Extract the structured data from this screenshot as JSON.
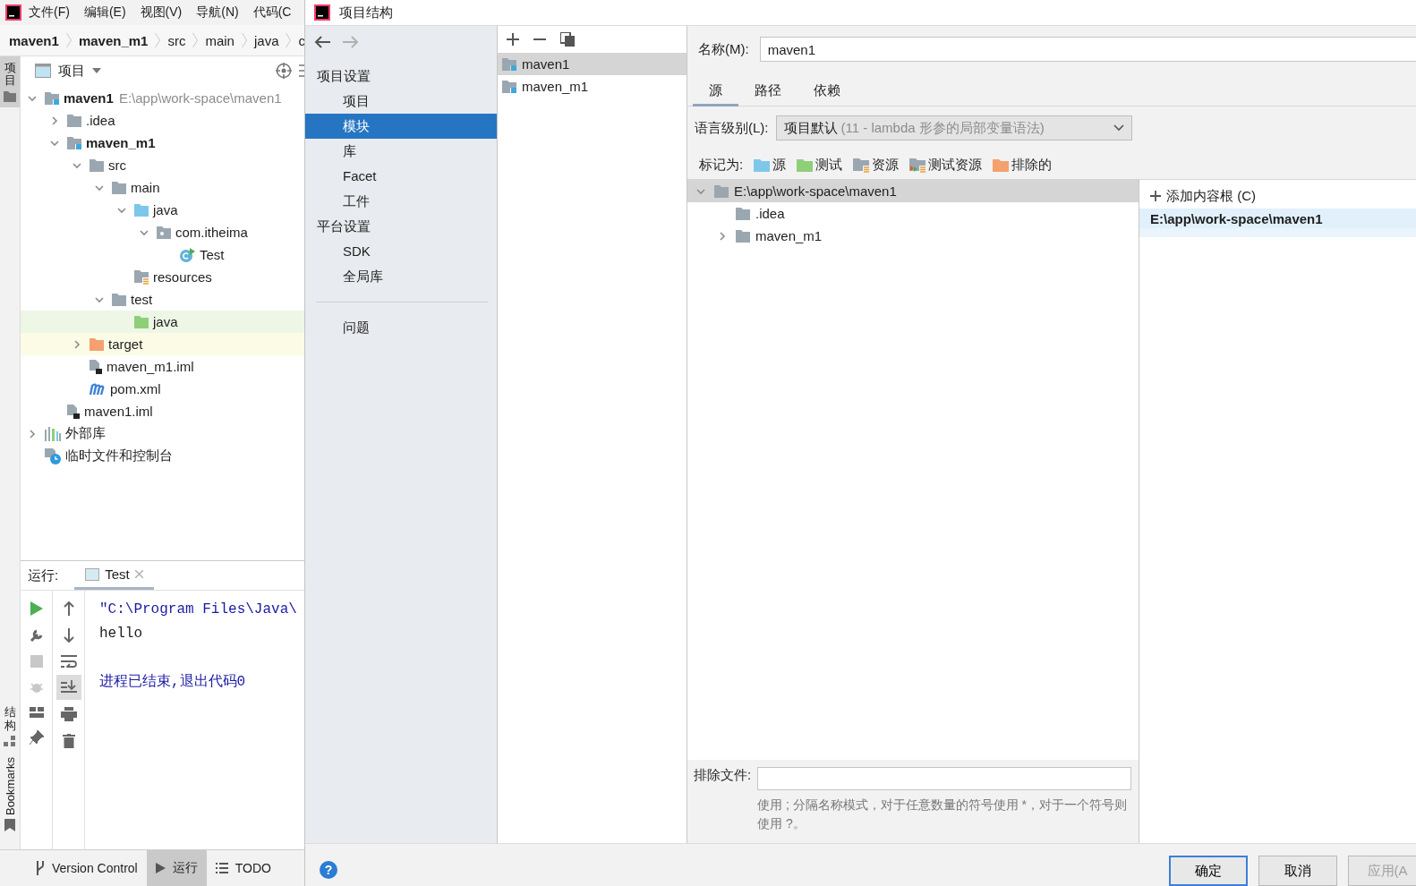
{
  "ide": {
    "menu": [
      "文件(F)",
      "编辑(E)",
      "视图(V)",
      "导航(N)",
      "代码(C"
    ],
    "breadcrumb": [
      {
        "label": "maven1",
        "bold": true
      },
      {
        "label": "maven_m1",
        "bold": true
      },
      {
        "label": "src",
        "bold": false
      },
      {
        "label": "main",
        "bold": false
      },
      {
        "label": "java",
        "bold": false
      },
      {
        "label": "c",
        "bold": false
      }
    ],
    "tool_windows": [
      {
        "label": "项目",
        "kind": "stacked",
        "selected": true
      },
      {
        "label": "结构",
        "kind": "stacked",
        "selected": false
      },
      {
        "label": "Bookmarks",
        "kind": "rotated",
        "selected": false
      }
    ],
    "project_panel": {
      "title": "项目",
      "tree": [
        {
          "label": "maven1",
          "kind": "module",
          "bold": true,
          "hint": "E:\\app\\work-space\\maven1",
          "expanded": true,
          "children": [
            {
              "label": ".idea",
              "kind": "folder",
              "expanded": false
            },
            {
              "label": "maven_m1",
              "kind": "module",
              "bold": true,
              "expanded": true,
              "children": [
                {
                  "label": "src",
                  "kind": "folder",
                  "expanded": true,
                  "children": [
                    {
                      "label": "main",
                      "kind": "folder",
                      "expanded": true,
                      "children": [
                        {
                          "label": "java",
                          "kind": "source",
                          "expanded": true,
                          "children": [
                            {
                              "label": "com.itheima",
                              "kind": "package",
                              "expanded": true,
                              "children": [
                                {
                                  "label": "Test",
                                  "kind": "class"
                                }
                              ]
                            }
                          ]
                        },
                        {
                          "label": "resources",
                          "kind": "resources"
                        }
                      ]
                    },
                    {
                      "label": "test",
                      "kind": "folder",
                      "expanded": true,
                      "children": [
                        {
                          "label": "java",
                          "kind": "test",
                          "color": "#eef7e6"
                        }
                      ]
                    }
                  ]
                },
                {
                  "label": "target",
                  "kind": "excluded",
                  "expanded": false,
                  "color": "#fcfce6"
                },
                {
                  "label": "maven_m1.iml",
                  "kind": "iml"
                },
                {
                  "label": "pom.xml",
                  "kind": "maven"
                }
              ]
            },
            {
              "label": "maven1.iml",
              "kind": "iml"
            }
          ]
        },
        {
          "label": "外部库",
          "kind": "libraries",
          "expanded": false
        },
        {
          "label": "临时文件和控制台",
          "kind": "scratches"
        }
      ]
    },
    "run_panel": {
      "label": "运行:",
      "tab": {
        "label": "Test",
        "selected": true
      },
      "console": [
        {
          "text": "\"C:\\Program Files\\Java\\",
          "kind": "command"
        },
        {
          "text": "hello",
          "kind": "output"
        },
        {
          "text": "进程已结束,退出代码0",
          "kind": "system"
        }
      ]
    },
    "status_bar": [
      {
        "label": "Version Control",
        "selected": false
      },
      {
        "label": "运行",
        "selected": true
      },
      {
        "label": "TODO",
        "selected": false
      }
    ]
  },
  "dialog": {
    "title": "项目结构",
    "nav": [
      {
        "kind": "header",
        "label": "项目设置"
      },
      {
        "kind": "item",
        "label": "项目",
        "selected": false
      },
      {
        "kind": "item",
        "label": "模块",
        "selected": true
      },
      {
        "kind": "item",
        "label": "库",
        "selected": false
      },
      {
        "kind": "item",
        "label": "Facet",
        "selected": false
      },
      {
        "kind": "item",
        "label": "工件",
        "selected": false
      },
      {
        "kind": "header",
        "label": "平台设置"
      },
      {
        "kind": "item",
        "label": "SDK",
        "selected": false
      },
      {
        "kind": "item",
        "label": "全局库",
        "selected": false
      },
      {
        "kind": "footer",
        "label": "问题",
        "selected": false
      }
    ],
    "modules": [
      {
        "label": "maven1",
        "selected": true
      },
      {
        "label": "maven_m1",
        "selected": false
      }
    ],
    "name": {
      "label": "名称(M):",
      "value": "maven1"
    },
    "tabs": [
      {
        "label": "源",
        "selected": true
      },
      {
        "label": "路径",
        "selected": false
      },
      {
        "label": "依赖",
        "selected": false
      }
    ],
    "language_level": {
      "label": "语言级别(L):",
      "value": "项目默认",
      "detail": "(11 - lambda 形参的局部变量语法)"
    },
    "mark_as": {
      "label": "标记为:",
      "tags": [
        {
          "label": "源",
          "kind": "folder",
          "color": "#7ec7ea"
        },
        {
          "label": "测试",
          "kind": "folder",
          "color": "#8ecf7a"
        },
        {
          "label": "资源",
          "kind": "resource",
          "color": "#9aa7b0"
        },
        {
          "label": "测试资源",
          "kind": "test_resource",
          "color": "#9aa7b0"
        },
        {
          "label": "排除的",
          "kind": "folder",
          "color": "#f5a06f"
        }
      ]
    },
    "content_tree": [
      {
        "label": "E:\\app\\work-space\\maven1",
        "expanded": true,
        "selected": true,
        "children": [
          {
            "label": ".idea",
            "selected": false
          },
          {
            "label": "maven_m1",
            "expanded": false,
            "selected": false
          }
        ]
      }
    ],
    "content_roots": {
      "add_label": "添加内容根 (C)",
      "roots": [
        {
          "label": "E:\\app\\work-space\\maven1",
          "selected": true
        }
      ]
    },
    "exclude": {
      "label": "排除文件:",
      "hint": "使用 ; 分隔名称模式，对于任意数量的符号使用 *，对于一个符号则使用 ?。"
    },
    "help": "?",
    "buttons": [
      {
        "label": "确定",
        "kind": "default",
        "disabled": false
      },
      {
        "label": "取消",
        "kind": "normal",
        "disabled": false
      },
      {
        "label": "应用(A",
        "kind": "normal",
        "disabled": true
      }
    ]
  }
}
